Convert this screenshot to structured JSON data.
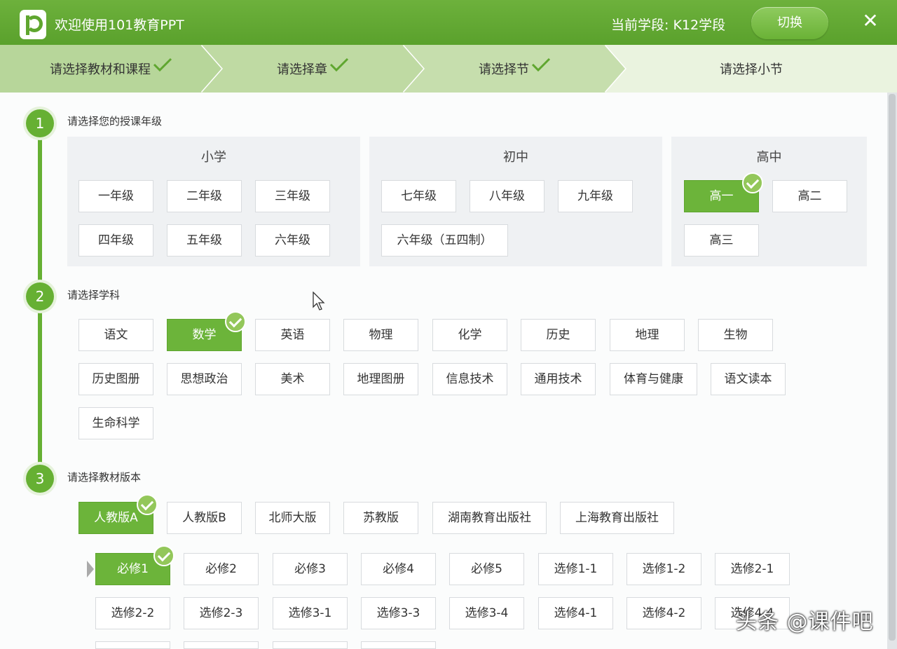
{
  "titlebar": {
    "app_title": "欢迎使用101教育PPT",
    "stage_label": "当前学段: K12学段",
    "switch_label": "切换"
  },
  "steps": [
    {
      "label": "请选择教材和课程",
      "done": true
    },
    {
      "label": "请选择章",
      "done": true
    },
    {
      "label": "请选择节",
      "done": true
    },
    {
      "label": "请选择小节",
      "done": false
    }
  ],
  "section1": {
    "number": "1",
    "title": "请选择您的授课年级",
    "groups": [
      {
        "title": "小学",
        "items": [
          "一年级",
          "二年级",
          "三年级",
          "四年级",
          "五年级",
          "六年级"
        ]
      },
      {
        "title": "初中",
        "items": [
          "七年级",
          "八年级",
          "九年级",
          "六年级（五四制）"
        ]
      },
      {
        "title": "高中",
        "items": [
          "高一",
          "高二",
          "高三"
        ],
        "selected": "高一"
      }
    ]
  },
  "section2": {
    "number": "2",
    "title": "请选择学科",
    "items": [
      "语文",
      "数学",
      "英语",
      "物理",
      "化学",
      "历史",
      "地理",
      "生物",
      "历史图册",
      "思想政治",
      "美术",
      "地理图册",
      "信息技术",
      "通用技术",
      "体育与健康",
      "语文读本",
      "生命科学"
    ],
    "selected": "数学"
  },
  "section3": {
    "number": "3",
    "title": "请选择教材版本",
    "editions": [
      "人教版A",
      "人教版B",
      "北师大版",
      "苏教版",
      "湖南教育出版社",
      "上海教育出版社"
    ],
    "selected_edition": "人教版A",
    "volumes": [
      "必修1",
      "必修2",
      "必修3",
      "必修4",
      "必修5",
      "选修1-1",
      "选修1-2",
      "选修2-1",
      "选修2-2",
      "选修2-3",
      "选修3-1",
      "选修3-3",
      "选修3-4",
      "选修4-1",
      "选修4-2",
      "选修4-4"
    ],
    "selected_volume": "必修1"
  },
  "watermark": "头条 @课件吧",
  "colors": {
    "accent": "#66b033",
    "selected": "#6cb43a",
    "check": "#93c75a"
  }
}
